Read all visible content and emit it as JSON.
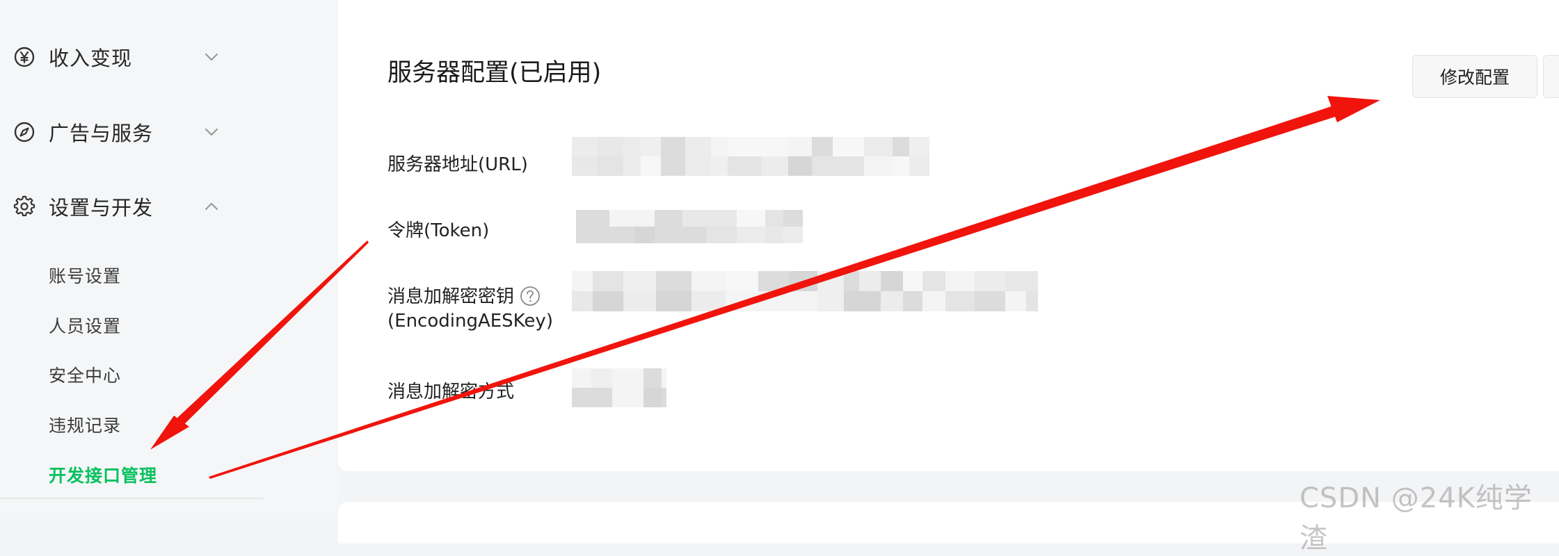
{
  "sidebar": {
    "groups": [
      {
        "label": "收入变现",
        "icon": "yen-circle-icon",
        "expanded": false
      },
      {
        "label": "广告与服务",
        "icon": "compass-icon",
        "expanded": false
      },
      {
        "label": "设置与开发",
        "icon": "gear-icon",
        "expanded": true
      }
    ],
    "sub_items": [
      {
        "label": "账号设置",
        "active": false
      },
      {
        "label": "人员设置",
        "active": false
      },
      {
        "label": "安全中心",
        "active": false
      },
      {
        "label": "违规记录",
        "active": false
      },
      {
        "label": "开发接口管理",
        "active": true
      }
    ]
  },
  "server_config": {
    "title": "服务器配置(已启用)",
    "modify_button": "修改配置",
    "fields": [
      {
        "label": "服务器地址(URL)",
        "value_redacted": true
      },
      {
        "label": "令牌(Token)",
        "value_redacted": true
      },
      {
        "label": "消息加解密密钥",
        "label_line2": "(EncodingAESKey)",
        "has_help": true,
        "value_redacted": true
      },
      {
        "label": "消息加解密方式",
        "value_redacted": true
      }
    ]
  },
  "watermark": "CSDN @24K纯学渣",
  "colors": {
    "accent_green": "#07c160",
    "annotation_red": "#f0140c",
    "sidebar_bg": "#f5f6f7",
    "card_bg": "#ffffff"
  }
}
